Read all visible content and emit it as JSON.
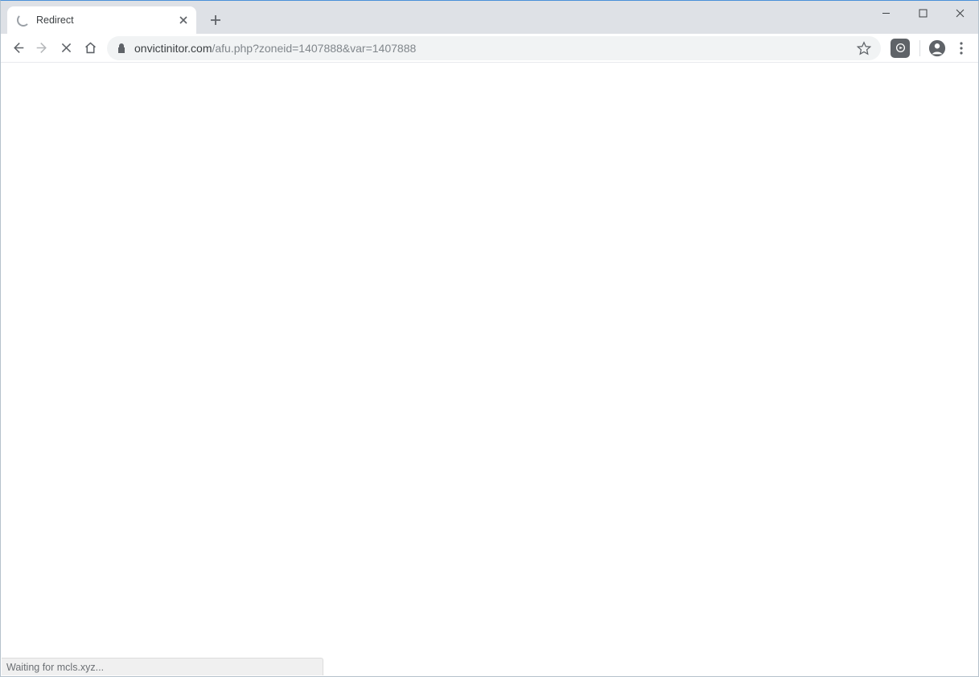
{
  "tab": {
    "title": "Redirect"
  },
  "url": {
    "domain": "onvictinitor.com",
    "path": "/afu.php?zoneid=1407888&var=1407888"
  },
  "status_text": "Waiting for mcls.xyz..."
}
